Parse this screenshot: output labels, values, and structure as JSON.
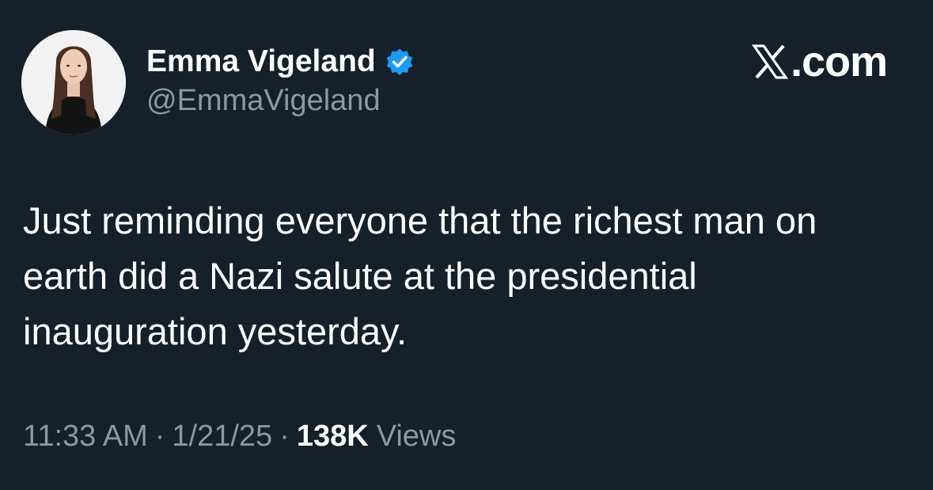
{
  "author": {
    "display_name": "Emma Vigeland",
    "handle": "@EmmaVigeland",
    "verified": true,
    "avatar_icon": "profile-photo-avatar"
  },
  "branding": {
    "logo_icon": "x-logo-icon",
    "site_text": ".com"
  },
  "tweet": {
    "text": "Just reminding everyone that the richest man on\nearth did a Nazi salute at the presidential\ninauguration yesterday."
  },
  "meta": {
    "time": "11:33 AM",
    "separator": "·",
    "date": "1/21/25",
    "views_count": "138K",
    "views_label": "Views"
  },
  "colors": {
    "background": "#15202b",
    "primary_text": "#ffffff",
    "secondary_text": "#8b98a5",
    "verified_blue": "#1d9bf0"
  }
}
